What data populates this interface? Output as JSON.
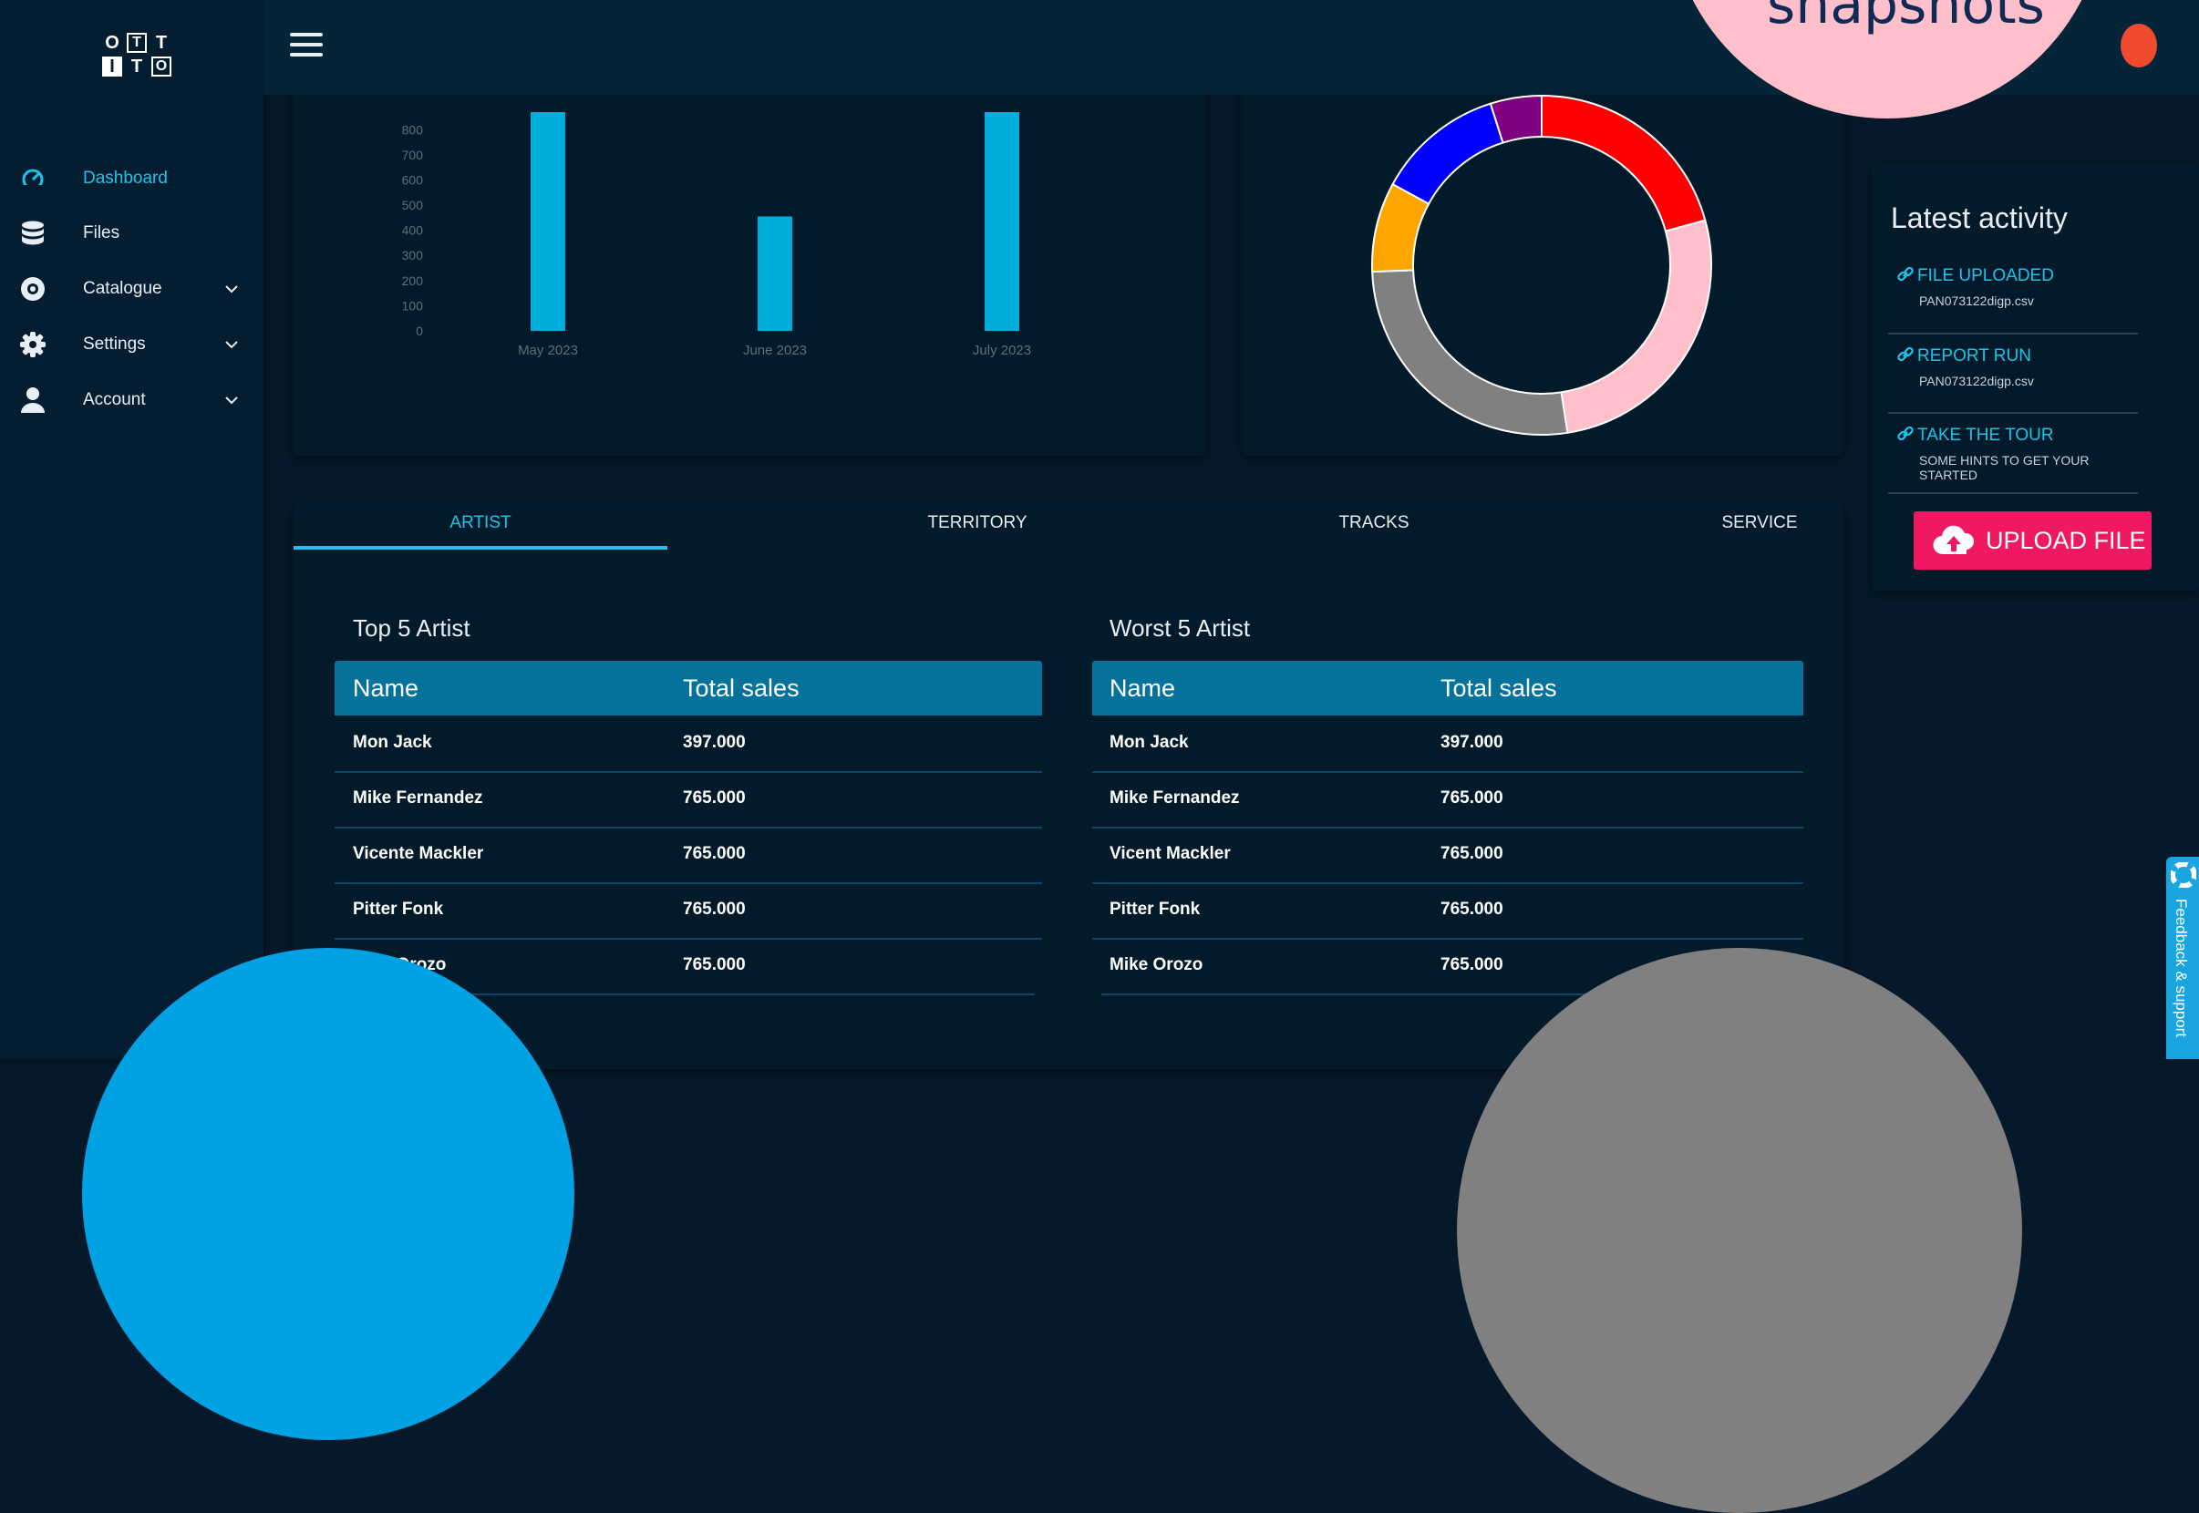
{
  "logo": {
    "cells": [
      "O",
      "T",
      "T",
      "I",
      "T",
      "O"
    ]
  },
  "sidebar": {
    "items": [
      {
        "label": "Dashboard",
        "icon": "speedometer-icon",
        "active": true
      },
      {
        "label": "Files",
        "icon": "database-icon"
      },
      {
        "label": "Catalogue",
        "icon": "disc-icon",
        "expandable": true
      },
      {
        "label": "Settings",
        "icon": "gear-icon",
        "expandable": true
      },
      {
        "label": "Account",
        "icon": "user-icon",
        "expandable": true
      }
    ]
  },
  "overlay": {
    "text": "snapshots"
  },
  "chart_data": [
    {
      "type": "bar",
      "categories": [
        "May 2023",
        "June 2023",
        "July 2023"
      ],
      "values": [
        870,
        455,
        870
      ],
      "yticks": [
        "0",
        "100",
        "200",
        "300",
        "400",
        "500",
        "600",
        "700",
        "800"
      ],
      "ylim": [
        0,
        870
      ],
      "color": "#00aedc"
    },
    {
      "type": "pie",
      "values": [
        17,
        22,
        22,
        7,
        10,
        4
      ],
      "colors": [
        "#ff0000",
        "#ffc0cb",
        "#808080",
        "#ffa500",
        "#0000ff",
        "#800080"
      ]
    }
  ],
  "tabs": [
    "ARTIST",
    "TERRITORY",
    "TRACKS",
    "SERVICE"
  ],
  "top_table": {
    "title": "Top 5 Artist",
    "headers": [
      "Name",
      "Total sales"
    ],
    "rows": [
      [
        "Mon Jack",
        "397.000"
      ],
      [
        "Mike Fernandez",
        "765.000"
      ],
      [
        "Vicente Mackler",
        "765.000"
      ],
      [
        "Pitter Fonk",
        "765.000"
      ],
      [
        "Mike Orozo",
        "765.000"
      ]
    ]
  },
  "worst_table": {
    "title": "Worst 5 Artist",
    "headers": [
      "Name",
      "Total sales"
    ],
    "rows": [
      [
        "Mon Jack",
        "397.000"
      ],
      [
        "Mike Fernandez",
        "765.000"
      ],
      [
        "Vicent Mackler",
        "765.000"
      ],
      [
        "Pitter Fonk",
        "765.000"
      ],
      [
        "Mike Orozo",
        "765.000"
      ]
    ]
  },
  "activity": {
    "title": "Latest activity",
    "items": [
      {
        "label": "FILE UPLOADED",
        "sub": "PAN073122digp.csv"
      },
      {
        "label": "REPORT RUN",
        "sub": "PAN073122digp.csv"
      },
      {
        "label": "TAKE THE TOUR",
        "sub": "SOME HINTS TO GET YOUR STARTED"
      }
    ],
    "upload_label": "UPLOAD FILE"
  },
  "feedback": {
    "label": "Feedback & support"
  },
  "colors": {
    "accent": "#1bc4e8",
    "upload": "#f01763",
    "table_head": "#05729b",
    "overlay_pink": "#ffc0cb",
    "overlay_blue": "#00a2e3",
    "overlay_gray": "#808080"
  }
}
